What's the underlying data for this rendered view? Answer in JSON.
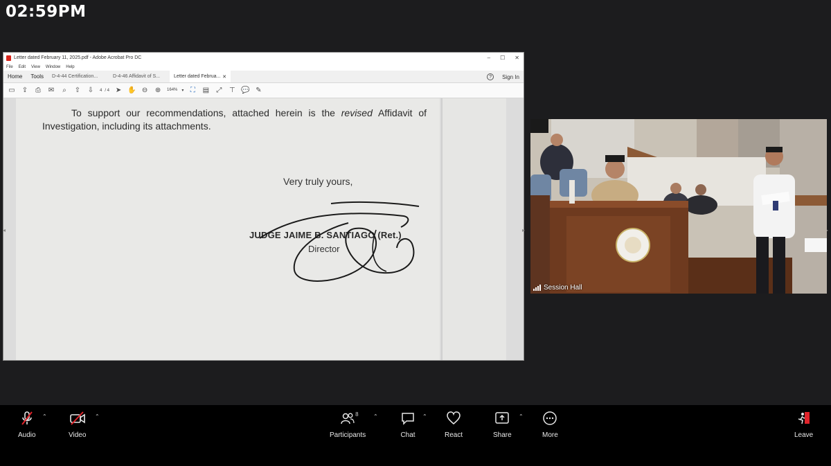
{
  "clock": "02:59PM",
  "acrobat": {
    "window_title": "Letter dated February 11, 2025.pdf - Adobe Acrobat Pro DC",
    "menu": [
      "File",
      "Edit",
      "View",
      "Window",
      "Help"
    ],
    "home_tab": "Home",
    "tools_tab": "Tools",
    "doc_tabs": [
      {
        "label": "D-4-44 Certification...",
        "active": false
      },
      {
        "label": "D-4-46 Affidavit of S...",
        "active": false
      },
      {
        "label": "Letter dated Februa...",
        "active": true
      }
    ],
    "sign_in": "Sign In",
    "page_current": "4",
    "page_total": "/ 4",
    "zoom": "164%",
    "document": {
      "paragraph_before": "To support our recommendations, attached herein is the ",
      "paragraph_italic": "revised",
      "paragraph_after": " Affidavit of Investigation, including its attachments.",
      "closing": "Very truly yours,",
      "signatory": "JUDGE JAIME B. SANTIAGO (Ret.)",
      "title": "Director"
    }
  },
  "video": {
    "label": "Session Hall"
  },
  "controls": {
    "audio": "Audio",
    "video": "Video",
    "participants": "Participants",
    "participant_count": "8",
    "chat": "Chat",
    "react": "React",
    "share": "Share",
    "more": "More",
    "leave": "Leave"
  },
  "colors": {
    "leave_red": "#e0242b",
    "mute_red": "#e0242b",
    "acrobat_red": "#d9251c"
  }
}
